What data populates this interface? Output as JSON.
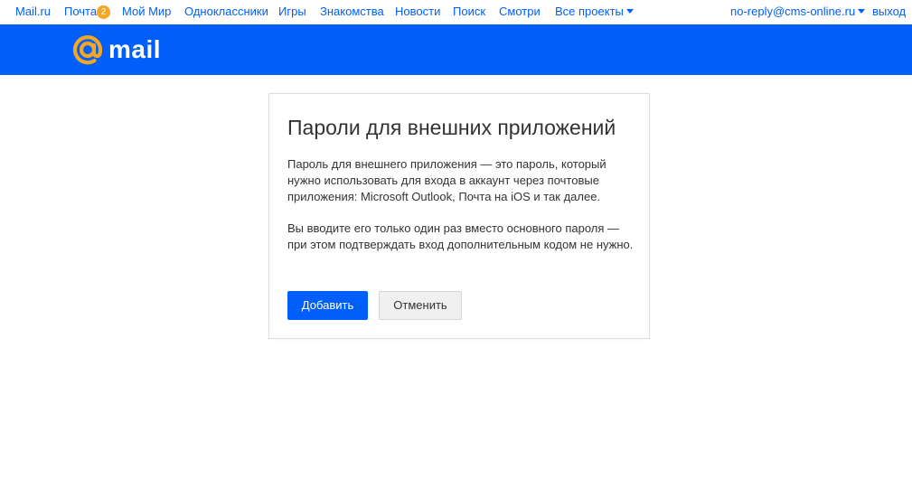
{
  "topnav": {
    "items": [
      {
        "label": "Mail.ru"
      },
      {
        "label": "Почта"
      },
      {
        "label": "Мой Мир"
      },
      {
        "label": "Одноклассники"
      },
      {
        "label": "Игры"
      },
      {
        "label": "Знакомства"
      },
      {
        "label": "Новости"
      },
      {
        "label": "Поиск"
      },
      {
        "label": "Смотри"
      },
      {
        "label": "Все проекты"
      }
    ],
    "mail_badge": "2",
    "account": "no-reply@cms-online.ru",
    "logout": "выход"
  },
  "brand": {
    "logo_text": "mail",
    "logo_color": "#f5a623",
    "bar_color": "#005ff9"
  },
  "dialog": {
    "title": "Пароли для внешних приложений",
    "paragraph1": "Пароль для внешнего приложения — это пароль, который нужно использовать для входа в аккаунт через почтовые приложения: Microsoft Outlook, Почта на iOS и так далее.",
    "paragraph2": "Вы вводите его только один раз вместо основного пароля — при этом подтверждать вход дополнительным кодом не нужно.",
    "add_button": "Добавить",
    "cancel_button": "Отменить"
  }
}
